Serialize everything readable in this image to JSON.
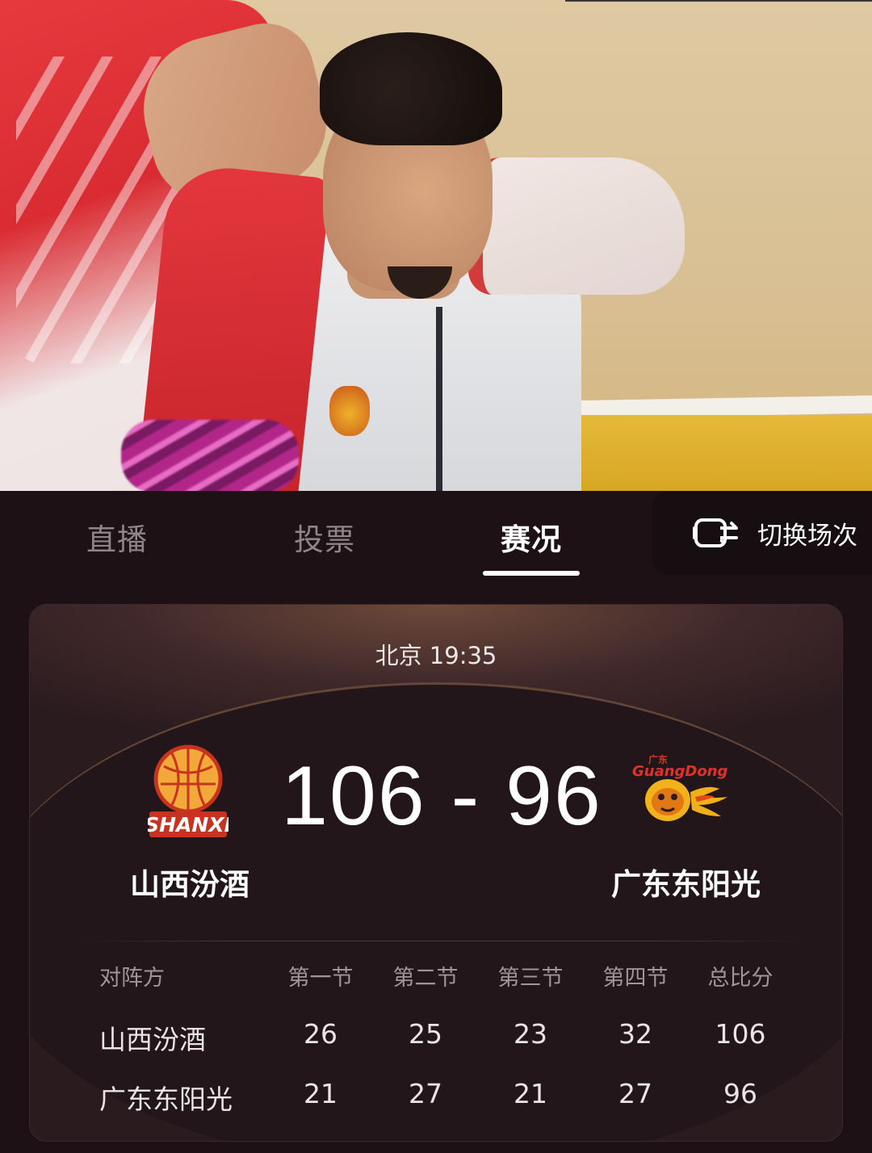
{
  "tabs": [
    {
      "label": "直播",
      "active": false
    },
    {
      "label": "投票",
      "active": false
    },
    {
      "label": "赛况",
      "active": true
    }
  ],
  "switch_match": {
    "label": "切换场次",
    "icon": "switch-match-icon"
  },
  "match": {
    "time": "北京 19:35",
    "score": "106 - 96",
    "home_team": {
      "name": "山西汾酒",
      "logo": "shanxi-logo"
    },
    "away_team": {
      "name": "广东东阳光",
      "logo": "guangdong-logo"
    }
  },
  "table": {
    "headers": [
      "对阵方",
      "第一节",
      "第二节",
      "第三节",
      "第四节",
      "总比分"
    ],
    "rows": [
      {
        "team": "山西汾酒",
        "q1": "26",
        "q2": "25",
        "q3": "23",
        "q4": "32",
        "total": "106"
      },
      {
        "team": "广东东阳光",
        "q1": "21",
        "q2": "27",
        "q3": "21",
        "q4": "27",
        "total": "96"
      }
    ]
  },
  "colors": {
    "background": "#1d1116",
    "card": "#2a1b1f",
    "accent_glow": "#6d4a3a"
  }
}
